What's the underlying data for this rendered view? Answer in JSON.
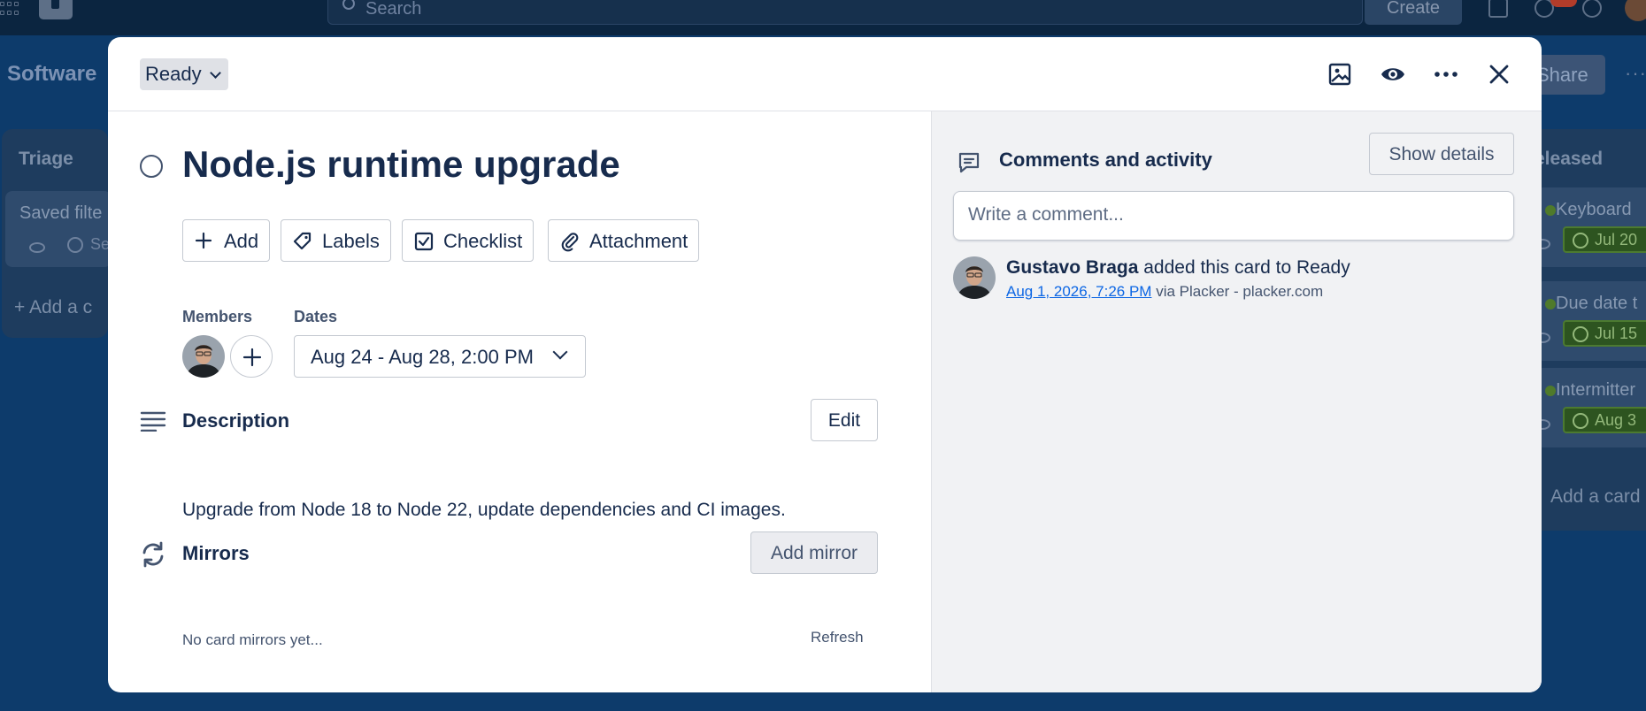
{
  "background": {
    "search_placeholder": "Search",
    "create_label": "Create",
    "board_title": "Software",
    "share_label": "Share",
    "more_label": "···",
    "lists": [
      {
        "title": "Triage",
        "cards": [
          {
            "title": "Saved filte",
            "meta": "Se"
          }
        ],
        "add_label": "Add a c"
      },
      {
        "title": "eleased",
        "cards": [
          {
            "title": "Keyboard",
            "date": "Jul 20"
          },
          {
            "title": "Due date t",
            "date": "Jul 15"
          },
          {
            "title": "Intermitter",
            "date": "Aug 3"
          }
        ],
        "add_label": "Add a card"
      }
    ]
  },
  "modal": {
    "status": "Ready",
    "header_icons": [
      "cover-image-icon",
      "watch-icon",
      "more-icon",
      "close-icon"
    ],
    "title": "Node.js runtime upgrade",
    "actions": [
      {
        "label": "Add",
        "icon": "plus-icon"
      },
      {
        "label": "Labels",
        "icon": "tag-icon"
      },
      {
        "label": "Checklist",
        "icon": "checklist-icon"
      },
      {
        "label": "Attachment",
        "icon": "paperclip-icon"
      }
    ],
    "members_label": "Members",
    "dates_label": "Dates",
    "dates_value": "Aug 24 - Aug 28, 2:00 PM",
    "description": {
      "title": "Description",
      "edit_label": "Edit",
      "text": "Upgrade from Node 18 to Node 22, update dependencies and CI images."
    },
    "mirrors": {
      "title": "Mirrors",
      "add_label": "Add mirror",
      "empty_text": "No card mirrors yet...",
      "refresh_label": "Refresh"
    },
    "comments": {
      "title": "Comments and activity",
      "show_details_label": "Show details",
      "input_placeholder": "Write a comment...",
      "activity": [
        {
          "user": "Gustavo Braga",
          "action": "added this card to Ready",
          "timestamp": "Aug 1, 2026, 7:26 PM",
          "source": "via Placker - placker.com"
        }
      ]
    }
  },
  "colors": {
    "board_bg": "#0d3b6b",
    "modal_bg": "#ffffff",
    "side_panel_bg": "#f1f2f4",
    "text_primary": "#172b4d",
    "link": "#0c66e4",
    "date_chip": "#2d5420"
  }
}
